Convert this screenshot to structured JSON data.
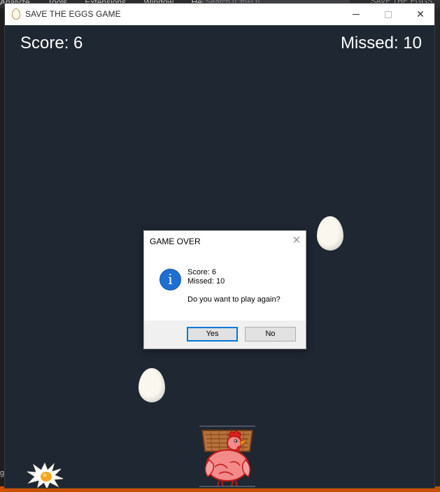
{
  "background_ide": {
    "menu_items": [
      "Analyze",
      "Tools",
      "Extensions",
      "Window",
      "Help"
    ],
    "search_placeholder": "Search (Ctrl+Q)",
    "right_title": "SAVE THE EGGS"
  },
  "window": {
    "title": "SAVE THE EGGS GAME",
    "icon": "egg-icon",
    "controls": {
      "minimize": "minimize-icon",
      "maximize": "maximize-icon",
      "close": "✕"
    }
  },
  "hud": {
    "score_label": "Score: 6",
    "missed_label": "Missed: 10"
  },
  "game_objects": {
    "falling_eggs": 2,
    "broken_egg": "splat-icon",
    "catcher": "hen-basket-icon"
  },
  "dialog": {
    "title": "GAME OVER",
    "close": "✕",
    "icon": "i",
    "score_line": "Score: 6",
    "missed_line": "Missed: 10",
    "question": "Do you want to play again?",
    "yes_label": "Yes",
    "no_label": "No"
  },
  "colors": {
    "game_background": "#1e2732",
    "dialog_primary_border": "#0078d7",
    "info_icon": "#1f6fd0",
    "taskbar_accent": "#ca5100"
  }
}
